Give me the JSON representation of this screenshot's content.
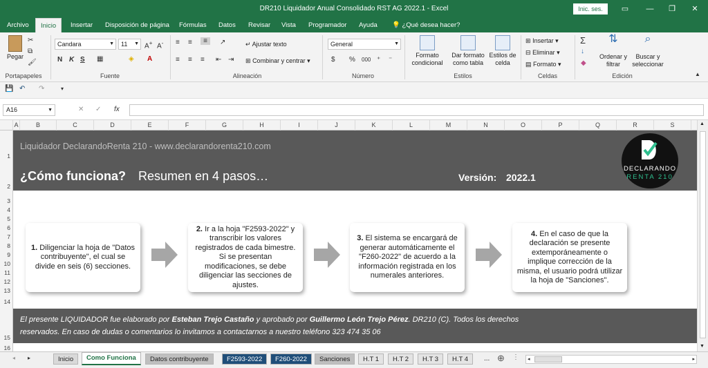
{
  "window": {
    "title": "DR210 Liquidador Anual Consolidado RST AG 2022.1  -  Excel",
    "login": "Inic. ses."
  },
  "tabs": [
    "Archivo",
    "Inicio",
    "Insertar",
    "Disposición de página",
    "Fórmulas",
    "Datos",
    "Revisar",
    "Vista",
    "Programador",
    "Ayuda",
    "¿Qué desea hacer?"
  ],
  "ribbon": {
    "clipboard": {
      "paste": "Pegar",
      "label": "Portapapeles"
    },
    "font": {
      "name": "Candara",
      "size": "11",
      "label": "Fuente",
      "bold": "N",
      "italic": "K",
      "underline": "S"
    },
    "alignment": {
      "wrap": "Ajustar texto",
      "merge": "Combinar y centrar",
      "label": "Alineación"
    },
    "number": {
      "format": "General",
      "currency": "$",
      "percent": "%",
      "thousands": "000",
      "label": "Número"
    },
    "styles": {
      "cond": "Formato condicional",
      "table": "Dar formato como tabla",
      "cell": "Estilos de celda",
      "label": "Estilos"
    },
    "cells": {
      "insert": "Insertar",
      "delete": "Eliminar",
      "format": "Formato",
      "label": "Celdas"
    },
    "editing": {
      "sort": "Ordenar y filtrar",
      "find": "Buscar y seleccionar",
      "label": "Edición"
    }
  },
  "namebox": "A16",
  "fx": "fx",
  "columns": [
    "A",
    "B",
    "C",
    "D",
    "E",
    "F",
    "G",
    "H",
    "I",
    "J",
    "K",
    "L",
    "M",
    "N",
    "O",
    "P",
    "Q",
    "R",
    "S"
  ],
  "rows": [
    "1",
    "2",
    "3",
    "4",
    "5",
    "6",
    "7",
    "8",
    "9",
    "10",
    "11",
    "12",
    "13",
    "14",
    "15",
    "16"
  ],
  "sheet": {
    "subtitle": "Liquidador DeclarandoRenta 210 - www.declarandorenta210.com",
    "heading": "¿Cómo funciona?",
    "heading2": "Resumen en 4 pasos…",
    "version_label": "Versión:",
    "version": "2022.1",
    "logo_line1": "DECLARANDO",
    "logo_line2": "RENTA 210",
    "steps": [
      {
        "num": "1.",
        "text": "Diligenciar la hoja de \"Datos contribuyente\", el cual se divide en seis (6) secciones."
      },
      {
        "num": "2.",
        "text": "Ir a la hoja \"F2593-2022\" y transcribir los valores registrados de cada bimestre. Si se presentan modificaciones, se debe diligenciar las secciones de ajustes."
      },
      {
        "num": "3.",
        "text": "El sistema se encargará de generar automáticamente el \"F260-2022\" de acuerdo a la información registrada en los numerales anteriores."
      },
      {
        "num": "4.",
        "text": "En el caso de que la declaración se presente extemporáneamente o implique corrección de la misma, el usuario podrá utilizar la hoja de \"Sanciones\"."
      }
    ],
    "footer_a": "El presente LIQUIDADOR fue elaborado por ",
    "footer_author1": "Esteban Trejo Castaño",
    "footer_b": " y aprobado por ",
    "footer_author2": "Guillermo León Trejo Pérez",
    "footer_c": ". DR210 (C). Todos los derechos",
    "footer_line2": "reservados. En caso de dudas o comentarios lo invitamos a contactarnos a nuestro teléfono 323 474 35 06"
  },
  "sheet_tabs": [
    "Inicio",
    "Como Funciona",
    "Datos contribuyente",
    "F2593-2022",
    "F260-2022",
    "Sanciones",
    "H.T 1",
    "H.T 2",
    "H.T 3",
    "H.T 4",
    "..."
  ],
  "colors": {
    "excel_green": "#217346",
    "band": "#595959",
    "tab_blue": "#1f4e79",
    "tab_gray": "#bfbfbf"
  }
}
